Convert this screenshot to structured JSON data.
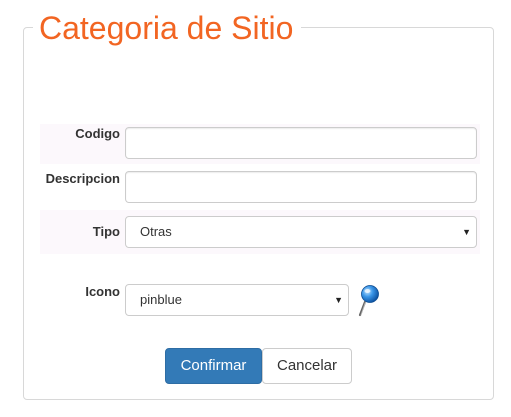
{
  "form": {
    "title": "Categoria de Sitio",
    "fields": {
      "codigo": {
        "label": "Codigo",
        "value": ""
      },
      "descripcion": {
        "label": "Descripcion",
        "value": ""
      },
      "tipo": {
        "label": "Tipo",
        "selected": "Otras"
      },
      "icono": {
        "label": "Icono",
        "selected": "pinblue",
        "preview_icon": "map-pin-blue-icon"
      }
    },
    "buttons": {
      "confirm": "Confirmar",
      "cancel": "Cancelar"
    }
  },
  "colors": {
    "title": "#f26522",
    "primary_button": "#337ab7",
    "row_highlight": "#fcf8fc",
    "pin": "#1e7fd8"
  }
}
